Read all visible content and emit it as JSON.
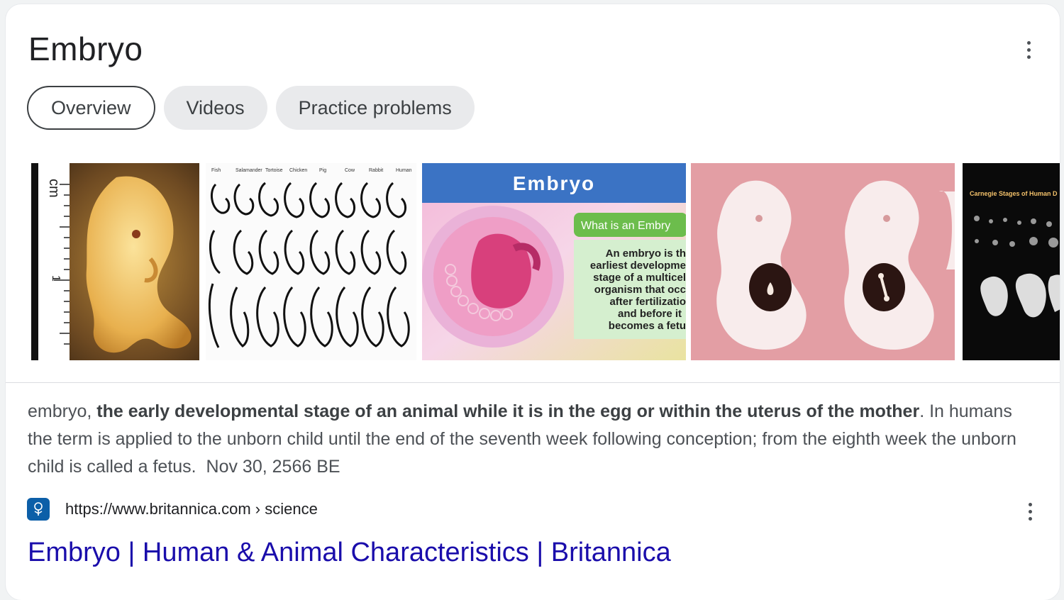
{
  "panel": {
    "title": "Embryo",
    "menu_icon": "more-vert-icon"
  },
  "tabs": [
    {
      "label": "Overview",
      "active": true
    },
    {
      "label": "Videos",
      "active": false
    },
    {
      "label": "Practice problems",
      "active": false
    }
  ],
  "images": {
    "thumb2_header": [
      "Fish",
      "Salamander",
      "Tortoise",
      "Chicken",
      "Pig",
      "Cow",
      "Rabbit",
      "Human"
    ],
    "thumb3": {
      "title": "Embryo",
      "box_title": "What is an Embry",
      "box_lines": [
        "An embryo is th",
        "earliest developme",
        "stage of a multicel",
        "organism that occ",
        "after fertilizatio",
        "and before it",
        "becomes a fetu"
      ]
    },
    "thumb5": {
      "title": "Carnegie Stages of Human D"
    }
  },
  "snippet": {
    "term": "embryo,",
    "definition_bold": "the early developmental stage of an animal while it is in the egg or within the uterus of the mother",
    "rest": ". In humans the term is applied to the unborn child until the end of the seventh week following conception; from the eighth week the unborn child is called a fetus.",
    "date": "Nov 30, 2566 BE"
  },
  "source": {
    "favicon_icon": "britannica-thistle-icon",
    "url": "https://www.britannica.com › science",
    "result_title": "Embryo | Human & Animal Characteristics | Britannica",
    "menu_icon": "more-vert-icon"
  },
  "colors": {
    "link": "#1a0dab",
    "text": "#4d5156",
    "chip_bg": "#e9eaec",
    "favicon_bg": "#0c5fa8"
  }
}
